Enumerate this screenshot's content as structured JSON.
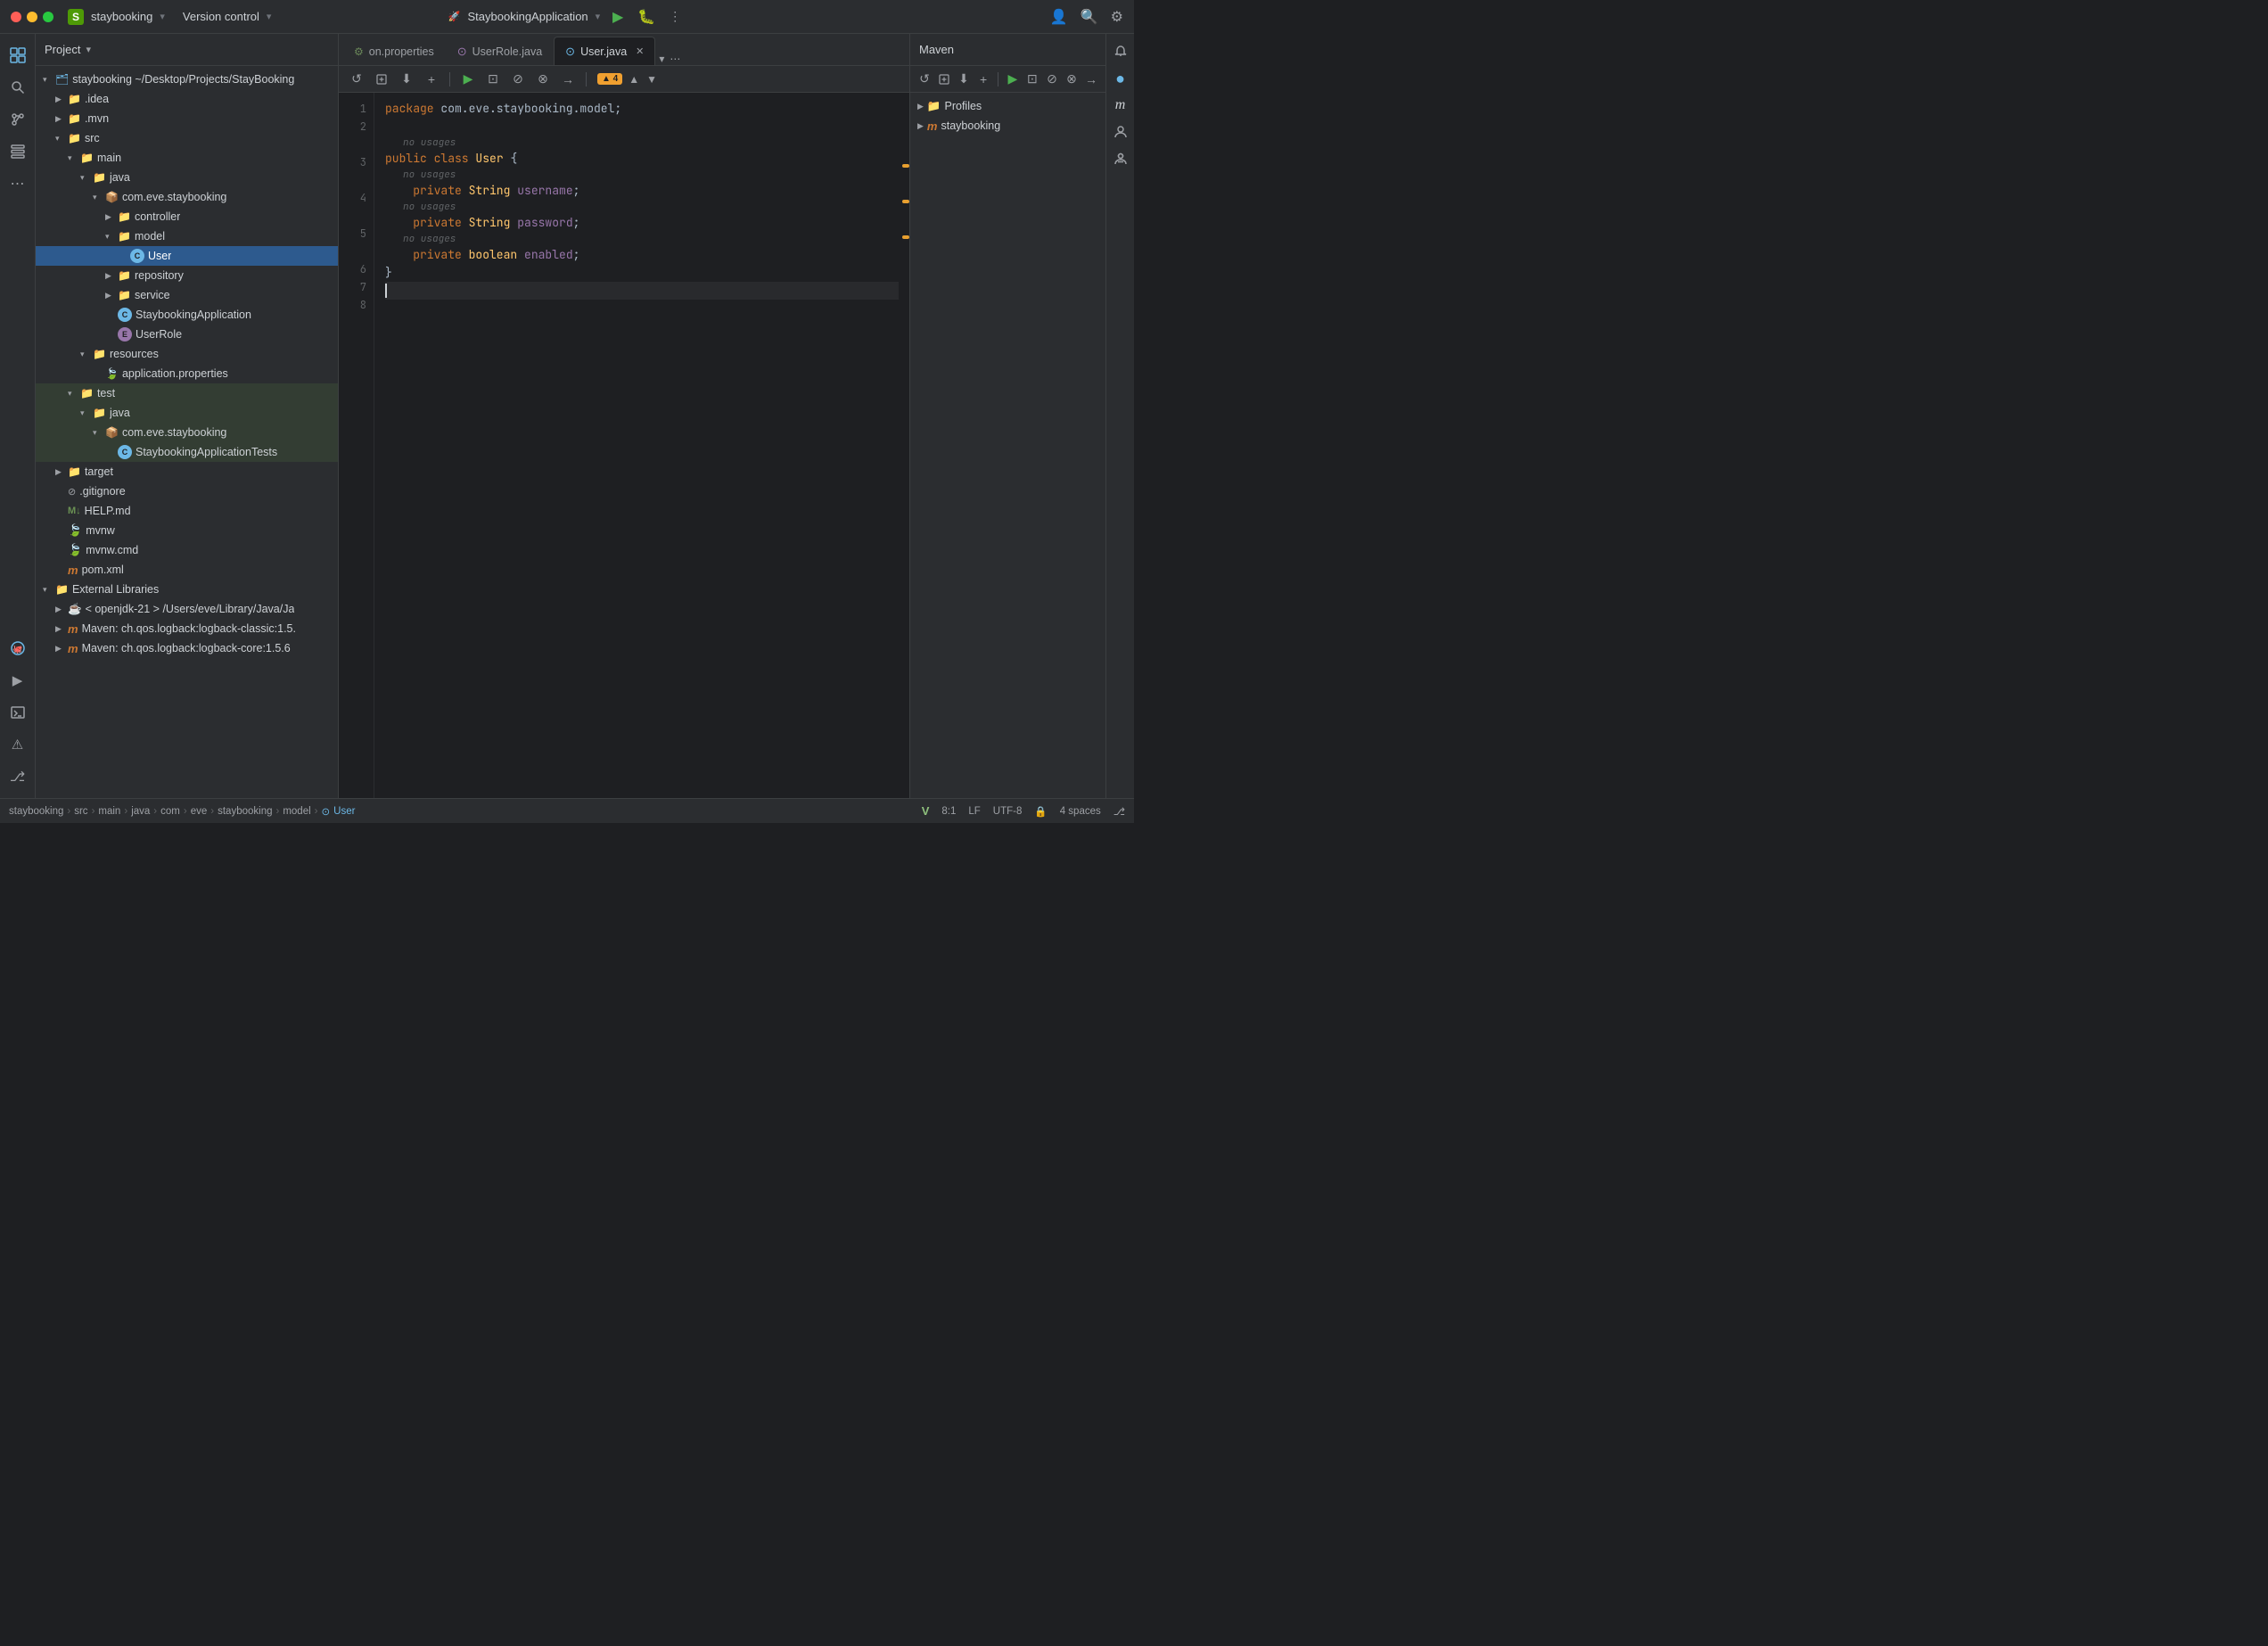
{
  "titlebar": {
    "project_icon": "S",
    "project_name": "staybooking",
    "project_dropdown": "▾",
    "version_control": "Version control",
    "version_dropdown": "▾",
    "run_config": "StaybookingApplication",
    "run_config_dropdown": "▾",
    "actions": [
      "▶",
      "🐛",
      "⋮"
    ],
    "account_icon": "👤",
    "search_icon": "🔍",
    "settings_icon": "⚙"
  },
  "sidebar": {
    "icons": [
      "☰",
      "🔍",
      "⋮⋮",
      "⊞",
      "⋯"
    ],
    "bottom_icons": [
      "🐙",
      "▶",
      "⊡",
      "⚠",
      "⎇"
    ]
  },
  "project_panel": {
    "title": "Project",
    "title_dropdown": "▾",
    "tree": [
      {
        "id": "staybooking-root",
        "indent": 0,
        "arrow": "▾",
        "icon": "🗂",
        "icon_class": "icon-folder",
        "label": "staybooking ~/Desktop/Projects/StayBooking",
        "type": "root"
      },
      {
        "id": "idea",
        "indent": 1,
        "arrow": "▶",
        "icon": "📁",
        "icon_class": "icon-folder",
        "label": ".idea",
        "type": "folder"
      },
      {
        "id": "mvn",
        "indent": 1,
        "arrow": "▶",
        "icon": "📁",
        "icon_class": "icon-folder",
        "label": ".mvn",
        "type": "folder"
      },
      {
        "id": "src",
        "indent": 1,
        "arrow": "▾",
        "icon": "📁",
        "icon_class": "icon-folder-src",
        "label": "src",
        "type": "folder"
      },
      {
        "id": "main",
        "indent": 2,
        "arrow": "▾",
        "icon": "📁",
        "icon_class": "icon-folder",
        "label": "main",
        "type": "folder"
      },
      {
        "id": "java",
        "indent": 3,
        "arrow": "▾",
        "icon": "📁",
        "icon_class": "icon-folder",
        "label": "java",
        "type": "folder"
      },
      {
        "id": "com-eve-staybooking",
        "indent": 4,
        "arrow": "▾",
        "icon": "📦",
        "icon_class": "icon-package",
        "label": "com.eve.staybooking",
        "type": "package"
      },
      {
        "id": "controller",
        "indent": 5,
        "arrow": "▶",
        "icon": "📁",
        "icon_class": "icon-folder",
        "label": "controller",
        "type": "folder"
      },
      {
        "id": "model",
        "indent": 5,
        "arrow": "▾",
        "icon": "📁",
        "icon_class": "icon-folder",
        "label": "model",
        "type": "folder"
      },
      {
        "id": "user",
        "indent": 6,
        "arrow": "",
        "icon": "⊙",
        "icon_class": "icon-java-class",
        "label": "User",
        "type": "class",
        "selected": true
      },
      {
        "id": "repository",
        "indent": 5,
        "arrow": "▶",
        "icon": "📁",
        "icon_class": "icon-folder",
        "label": "repository",
        "type": "folder"
      },
      {
        "id": "service",
        "indent": 5,
        "arrow": "▶",
        "icon": "📁",
        "icon_class": "icon-folder",
        "label": "service",
        "type": "folder"
      },
      {
        "id": "staybooking-app",
        "indent": 5,
        "arrow": "",
        "icon": "☘",
        "icon_class": "icon-spring",
        "label": "StaybookingApplication",
        "type": "class"
      },
      {
        "id": "userrole",
        "indent": 5,
        "arrow": "",
        "icon": "⊙",
        "icon_class": "icon-java-enum",
        "label": "UserRole",
        "type": "enum"
      },
      {
        "id": "resources",
        "indent": 3,
        "arrow": "▾",
        "icon": "📁",
        "icon_class": "icon-folder",
        "label": "resources",
        "type": "folder"
      },
      {
        "id": "app-properties",
        "indent": 4,
        "arrow": "",
        "icon": "⚙",
        "icon_class": "icon-properties",
        "label": "application.properties",
        "type": "properties"
      },
      {
        "id": "test",
        "indent": 2,
        "arrow": "▾",
        "icon": "📁",
        "icon_class": "icon-folder",
        "label": "test",
        "type": "folder"
      },
      {
        "id": "test-java",
        "indent": 3,
        "arrow": "▾",
        "icon": "📁",
        "icon_class": "icon-folder",
        "label": "java",
        "type": "folder"
      },
      {
        "id": "test-com",
        "indent": 4,
        "arrow": "▾",
        "icon": "📦",
        "icon_class": "icon-package",
        "label": "com.eve.staybooking",
        "type": "package"
      },
      {
        "id": "app-tests",
        "indent": 5,
        "arrow": "",
        "icon": "⊙",
        "icon_class": "icon-test",
        "label": "StaybookingApplicationTests",
        "type": "class"
      },
      {
        "id": "target",
        "indent": 1,
        "arrow": "▶",
        "icon": "📁",
        "icon_class": "icon-target",
        "label": "target",
        "type": "folder"
      },
      {
        "id": "gitignore",
        "indent": 1,
        "arrow": "",
        "icon": "⊘",
        "icon_class": "icon-gitignore",
        "label": ".gitignore",
        "type": "file"
      },
      {
        "id": "help-md",
        "indent": 1,
        "arrow": "",
        "icon": "M↓",
        "icon_class": "icon-markdown",
        "label": "HELP.md",
        "type": "file"
      },
      {
        "id": "mvnw",
        "indent": 1,
        "arrow": "",
        "icon": "⊡",
        "icon_class": "icon-maven",
        "label": "mvnw",
        "type": "file"
      },
      {
        "id": "mvnw-cmd",
        "indent": 1,
        "arrow": "",
        "icon": "⊡",
        "icon_class": "icon-maven",
        "label": "mvnw.cmd",
        "type": "file"
      },
      {
        "id": "pom-xml",
        "indent": 1,
        "arrow": "",
        "icon": "m",
        "icon_class": "icon-maven",
        "label": "pom.xml",
        "type": "file"
      },
      {
        "id": "external-libs",
        "indent": 0,
        "arrow": "▾",
        "icon": "📁",
        "icon_class": "icon-folder",
        "label": "External Libraries",
        "type": "folder"
      },
      {
        "id": "openjdk",
        "indent": 1,
        "arrow": "▶",
        "icon": "☕",
        "icon_class": "",
        "label": "< openjdk-21 > /Users/eve/Library/Java/Ja",
        "type": "sdk"
      },
      {
        "id": "logback-classic",
        "indent": 1,
        "arrow": "▶",
        "icon": "📦",
        "icon_class": "icon-maven",
        "label": "Maven: ch.qos.logback:logback-classic:1.5.",
        "type": "maven-dep"
      },
      {
        "id": "logback-core",
        "indent": 1,
        "arrow": "▶",
        "icon": "📦",
        "icon_class": "icon-maven",
        "label": "Maven: ch.qos.logback:logback-core:1.5.6",
        "type": "maven-dep"
      }
    ]
  },
  "tabs": [
    {
      "id": "application-properties",
      "label": "on.properties",
      "icon": "⚙",
      "icon_class": "tab-icon-properties",
      "active": false,
      "closable": false
    },
    {
      "id": "userrole-java",
      "label": "UserRole.java",
      "icon": "⊙",
      "icon_class": "tab-icon-java",
      "active": false,
      "closable": false
    },
    {
      "id": "user-java",
      "label": "User.java",
      "icon": "⊙",
      "icon_class": "tab-icon-user",
      "active": true,
      "closable": true
    }
  ],
  "editor": {
    "filename": "User.java",
    "warnings": "▲ 4",
    "code_lines": [
      {
        "num": 1,
        "tokens": [
          {
            "text": "package ",
            "cls": "kw"
          },
          {
            "text": "com.eve.staybooking.model",
            "cls": "package-name"
          },
          {
            "text": ";",
            "cls": "punc"
          }
        ],
        "annotation": "",
        "warn": false
      },
      {
        "num": 2,
        "tokens": [],
        "annotation": "",
        "warn": false
      },
      {
        "num": 3,
        "tokens": [
          {
            "text": "public ",
            "cls": "kw"
          },
          {
            "text": "class ",
            "cls": "kw-class"
          },
          {
            "text": "User ",
            "cls": "class-name"
          },
          {
            "text": "{",
            "cls": "punc"
          }
        ],
        "annotation": "no usages",
        "warn": false
      },
      {
        "num": 4,
        "tokens": [
          {
            "text": "    ",
            "cls": "plain"
          },
          {
            "text": "private ",
            "cls": "kw"
          },
          {
            "text": "String ",
            "cls": "type"
          },
          {
            "text": "username",
            "cls": "field-name"
          },
          {
            "text": ";",
            "cls": "punc"
          }
        ],
        "annotation": "no usages",
        "warn": true
      },
      {
        "num": 5,
        "tokens": [
          {
            "text": "    ",
            "cls": "plain"
          },
          {
            "text": "private ",
            "cls": "kw"
          },
          {
            "text": "String ",
            "cls": "type"
          },
          {
            "text": "password",
            "cls": "field-name"
          },
          {
            "text": ";",
            "cls": "punc"
          }
        ],
        "annotation": "no usages",
        "warn": true
      },
      {
        "num": 6,
        "tokens": [
          {
            "text": "    ",
            "cls": "plain"
          },
          {
            "text": "private ",
            "cls": "kw"
          },
          {
            "text": "boolean ",
            "cls": "type"
          },
          {
            "text": "enabled",
            "cls": "field-name"
          },
          {
            "text": ";",
            "cls": "punc"
          }
        ],
        "annotation": "no usages",
        "warn": true
      },
      {
        "num": 7,
        "tokens": [
          {
            "text": "}",
            "cls": "punc"
          }
        ],
        "annotation": "",
        "warn": false
      },
      {
        "num": 8,
        "tokens": [],
        "annotation": "",
        "warn": false,
        "cursor": true
      }
    ]
  },
  "maven_panel": {
    "title": "Maven",
    "toolbar_btns": [
      "↺",
      "+",
      "⬇",
      "+",
      "▶",
      "⊡",
      "⊘",
      "⊗",
      "→"
    ],
    "tree": [
      {
        "label": "Profiles",
        "arrow": "▶",
        "indent": 0
      },
      {
        "label": "staybooking",
        "arrow": "▶",
        "indent": 0,
        "icon": "m"
      }
    ]
  },
  "status_bar": {
    "breadcrumb": [
      "staybooking",
      "src",
      "main",
      "java",
      "com",
      "eve",
      "staybooking",
      "model",
      "User"
    ],
    "vim_mode": "V",
    "position": "8:1",
    "line_ending": "LF",
    "encoding": "UTF-8",
    "git_icon": "🔒",
    "indent": "4 spaces",
    "share_icon": "⎇"
  }
}
